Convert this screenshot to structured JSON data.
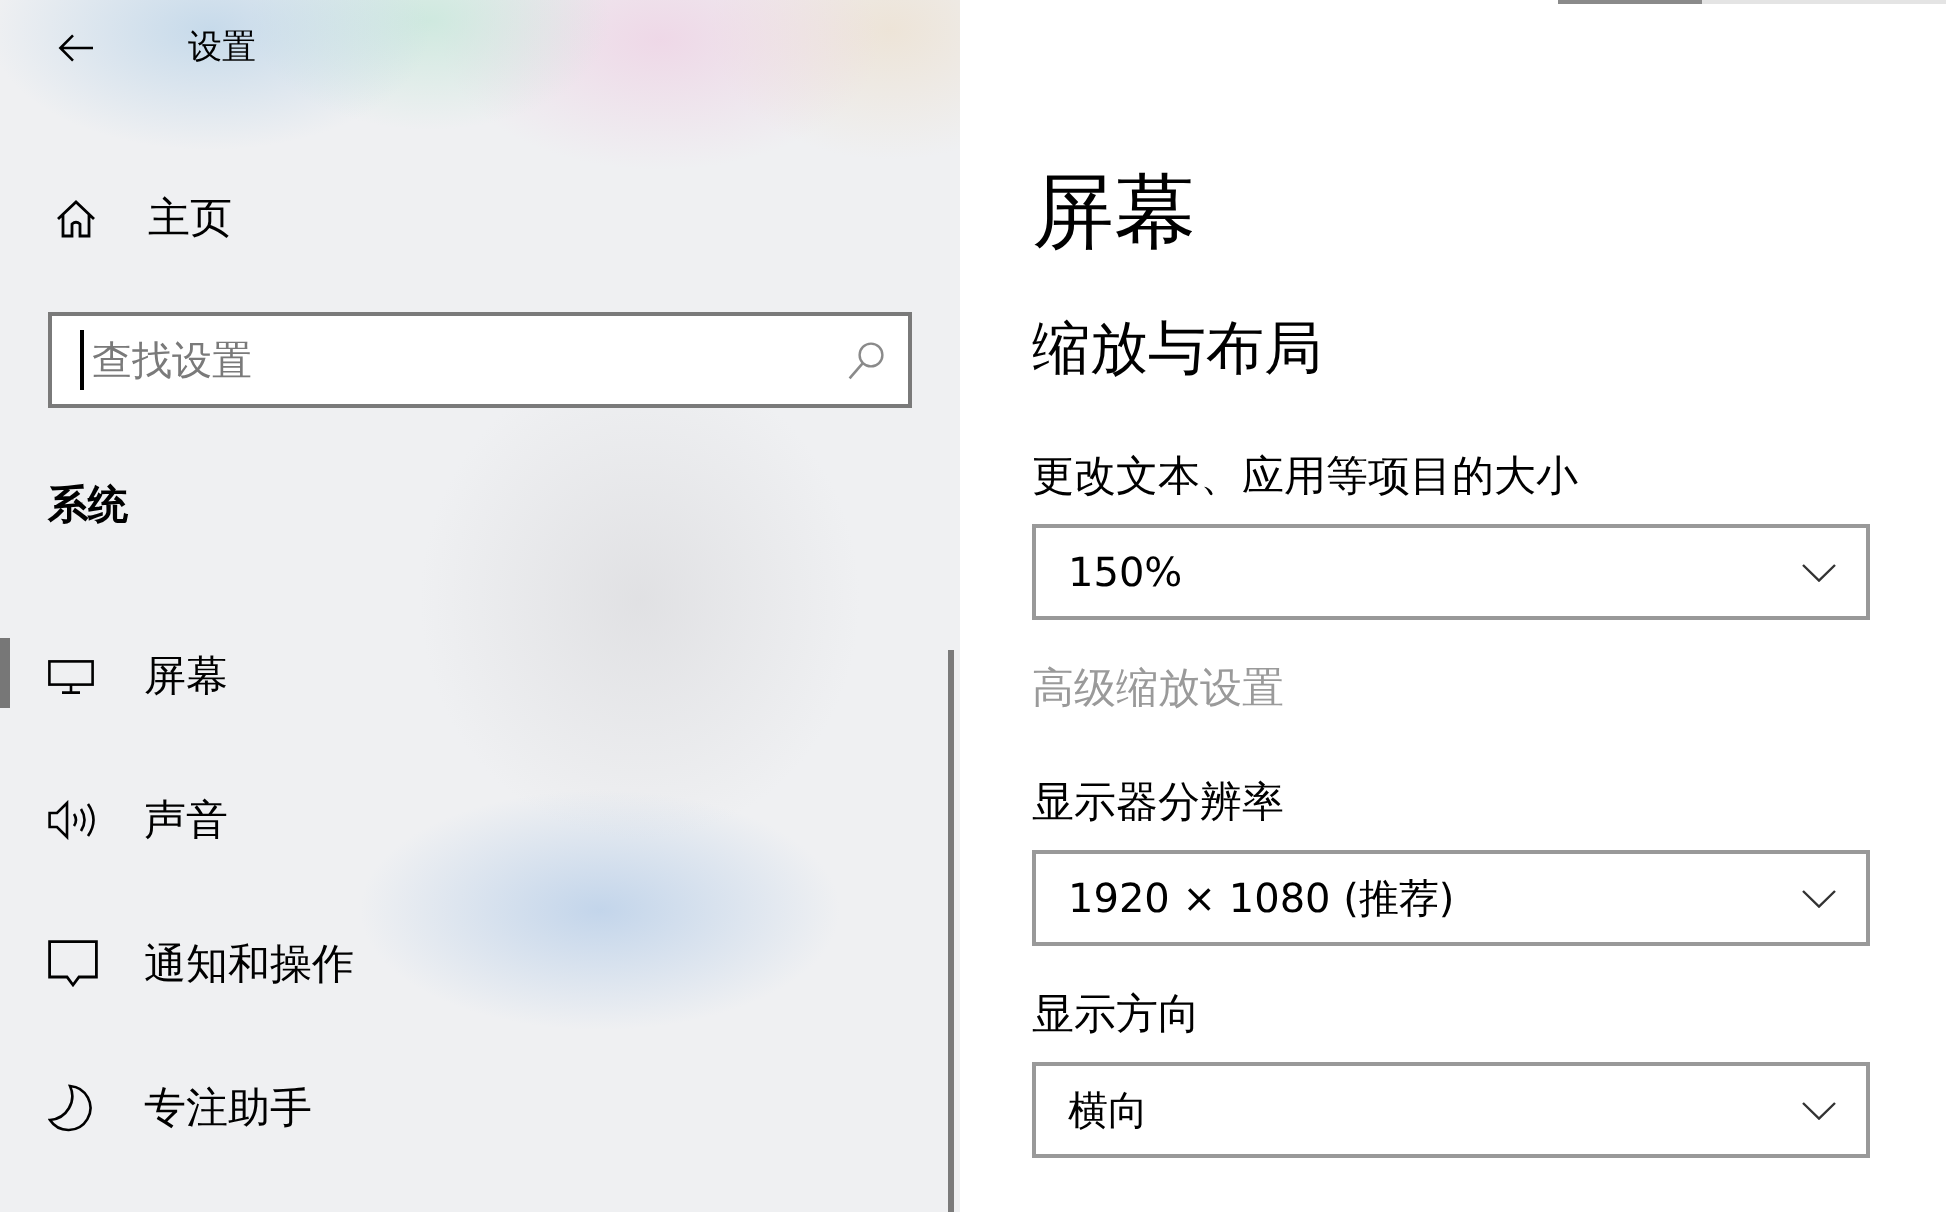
{
  "window": {
    "title": "设置"
  },
  "sidebar": {
    "home": {
      "label": "主页"
    },
    "search": {
      "placeholder": "查找设置",
      "focused": true
    },
    "section_title": "系统",
    "items": [
      {
        "label": "屏幕",
        "selected": true
      },
      {
        "label": "声音",
        "selected": false
      },
      {
        "label": "通知和操作",
        "selected": false
      },
      {
        "label": "专注助手",
        "selected": false
      }
    ]
  },
  "content": {
    "title": "屏幕",
    "section": "缩放与布局",
    "settings": [
      {
        "kind": "dropdown",
        "label": "更改文本、应用等项目的大小",
        "value": "150%"
      },
      {
        "kind": "link",
        "label": "高级缩放设置",
        "disabled": true
      },
      {
        "kind": "dropdown",
        "label": "显示器分辨率",
        "value": "1920 × 1080 (推荐)"
      },
      {
        "kind": "dropdown",
        "label": "显示方向",
        "value": "横向"
      }
    ]
  }
}
